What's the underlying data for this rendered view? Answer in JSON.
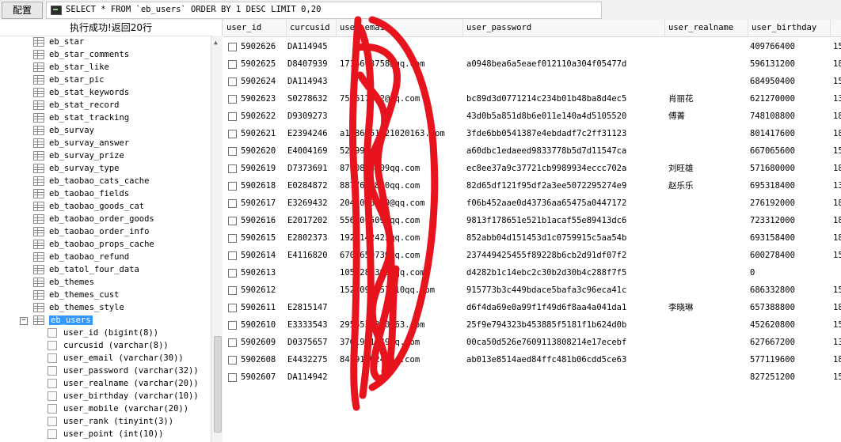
{
  "toolbar": {
    "config_label": "配置",
    "query_text": "SELECT * FROM `eb_users` ORDER BY 1 DESC LIMIT 0,20"
  },
  "left_panel": {
    "status_text": "执行成功!返回20行",
    "tables": [
      "eb_star",
      "eb_star_comments",
      "eb_star_like",
      "eb_star_pic",
      "eb_stat_keywords",
      "eb_stat_record",
      "eb_stat_tracking",
      "eb_survay",
      "eb_survay_answer",
      "eb_survay_prize",
      "eb_survay_type",
      "eb_taobao_cats_cache",
      "eb_taobao_fields",
      "eb_taobao_goods_cat",
      "eb_taobao_order_goods",
      "eb_taobao_order_info",
      "eb_taobao_props_cache",
      "eb_taobao_refund",
      "eb_tatol_four_data",
      "eb_themes",
      "eb_themes_cust",
      "eb_themes_style"
    ],
    "selected_table": "eb_users",
    "collapse_symbol": "−",
    "columns": [
      "user_id (bigint(8))",
      "curcusid (varchar(8))",
      "user_email (varchar(30))",
      "user_password (varchar(32))",
      "user_realname (varchar(20))",
      "user_birthday (varchar(10))",
      "user_mobile (varchar(20))",
      "user_rank (tinyint(3))",
      "user_point (int(10))"
    ]
  },
  "grid": {
    "headers": [
      "user_id",
      "curcusid",
      "user_email",
      "user_password",
      "user_realname",
      "user_birthday",
      ""
    ],
    "rows": [
      {
        "id": "5902626",
        "cus": "DA114945",
        "email": "",
        "pwd": "",
        "name": "",
        "bday": "409766400",
        "mob": "15"
      },
      {
        "id": "5902625",
        "cus": "D8407939",
        "email": "1716603758@qq.com",
        "pwd": "a0948bea6a5eaef012110a304f05477d",
        "name": "",
        "bday": "596131200",
        "mob": "18"
      },
      {
        "id": "5902624",
        "cus": "DA114943",
        "email": "",
        "pwd": "",
        "name": "",
        "bday": "684950400",
        "mob": "15"
      },
      {
        "id": "5902623",
        "cus": "S0278632",
        "email": "751617582@qq.com",
        "pwd": "bc89d3d0771214c234b01b48ba8d4ec5",
        "name": "肖丽花",
        "bday": "621270000",
        "mob": "13"
      },
      {
        "id": "5902622",
        "cus": "D9309273",
        "email": "",
        "pwd": "43d0b5a851d8b6e011e140a4d5105520",
        "name": "傅菁",
        "bday": "748108800",
        "mob": "18"
      },
      {
        "id": "5902621",
        "cus": "E2394246",
        "email": "a1586351021020163.com",
        "pwd": "3fde6bb0541387e4ebdadf7c2ff31123",
        "name": "",
        "bday": "801417600",
        "mob": "18"
      },
      {
        "id": "5902620",
        "cus": "E4004169",
        "email": "52999",
        "pwd": "a60dbc1edaeed9833778b5d7d11547ca",
        "name": "",
        "bday": "667065600",
        "mob": "15"
      },
      {
        "id": "5902619",
        "cus": "D7373691",
        "email": "8700803509qq.com",
        "pwd": "ec8ee37a9c37721cb9989934eccc702a",
        "name": "刘旺雄",
        "bday": "571680000",
        "mob": "18"
      },
      {
        "id": "5902618",
        "cus": "E0284872",
        "email": "8877608860qq.com",
        "pwd": "82d65df121f95df2a3ee5072295274e9",
        "name": "赵乐乐",
        "bday": "695318400",
        "mob": "13"
      },
      {
        "id": "5902617",
        "cus": "E3269432",
        "email": "2045066759@qq.com",
        "pwd": "f06b452aae0d43736aa65475a0447172",
        "name": "",
        "bday": "276192000",
        "mob": "18"
      },
      {
        "id": "5902616",
        "cus": "E2017202",
        "email": "5569065099qq.com",
        "pwd": "9813f178651e521b1acaf55e89413dc6",
        "name": "",
        "bday": "723312000",
        "mob": "18"
      },
      {
        "id": "5902615",
        "cus": "E2802373",
        "email": "1923142423qq.com",
        "pwd": "852abb04d151453d1c0759915c5aa54b",
        "name": "",
        "bday": "693158400",
        "mob": "18"
      },
      {
        "id": "5902614",
        "cus": "E4116820",
        "email": "6700659739qq.com",
        "pwd": "237449425455f89228b6cb2d91df07f2",
        "name": "",
        "bday": "600278400",
        "mob": "15"
      },
      {
        "id": "5902613",
        "cus": "",
        "email": "1052280399@qq.com",
        "pwd": "d4282b1c14ebc2c30b2d30b4c288f7f5",
        "name": "",
        "bday": "0",
        "mob": ""
      },
      {
        "id": "5902612",
        "cus": "",
        "email": "1522098457510qq.com",
        "pwd": "915773b3c449bdace5bafa3c96eca41c",
        "name": "",
        "bday": "686332800",
        "mob": "15"
      },
      {
        "id": "5902611",
        "cus": "E2815147",
        "email": "",
        "pwd": "d6f4da69e0a99f1f49d6f8aa4a041da1",
        "name": "李晓琳",
        "bday": "657388800",
        "mob": "18"
      },
      {
        "id": "5902610",
        "cus": "E3333543",
        "email": "2956538380163.com",
        "pwd": "25f9e794323b453885f5181f1b624d0b",
        "name": "",
        "bday": "452620800",
        "mob": "15"
      },
      {
        "id": "5902609",
        "cus": "D0375657",
        "email": "3761981949qq.com",
        "pwd": "00ca50d526e7609113808214e17ecebf",
        "name": "",
        "bday": "627667200",
        "mob": "13"
      },
      {
        "id": "5902608",
        "cus": "E4432275",
        "email": "8479120240qq.com",
        "pwd": "ab013e8514aed84ffc481b06cdd5ce63",
        "name": "",
        "bday": "577119600",
        "mob": "18"
      },
      {
        "id": "5902607",
        "cus": "DA114942",
        "email": "",
        "pwd": "",
        "name": "",
        "bday": "827251200",
        "mob": "15"
      }
    ]
  },
  "annotation": {
    "color": "#e8141d"
  }
}
